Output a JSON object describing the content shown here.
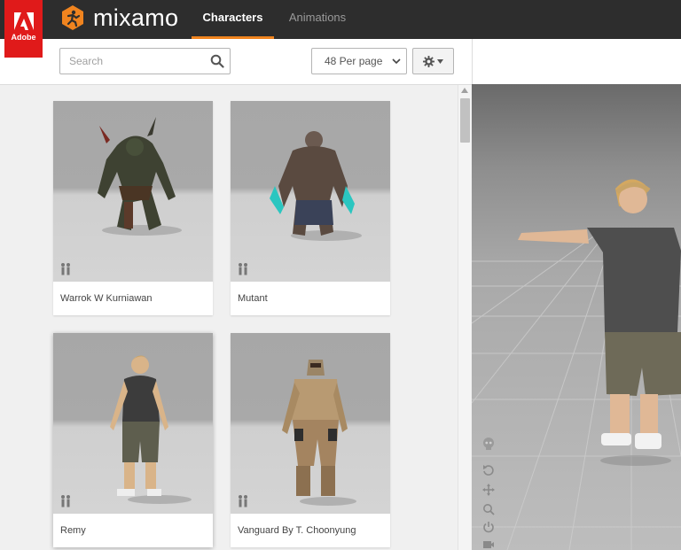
{
  "adobe": {
    "label": "Adobe"
  },
  "brand": {
    "name": "mixamo"
  },
  "nav": {
    "tabs": [
      {
        "label": "Characters",
        "active": true
      },
      {
        "label": "Animations",
        "active": false
      }
    ]
  },
  "toolbar": {
    "search_placeholder": "Search",
    "per_page": "48 Per page",
    "settings_icon": "gear-icon"
  },
  "characters": [
    {
      "name": "Warrok W Kurniawan",
      "icon": "people-icon"
    },
    {
      "name": "Mutant",
      "icon": "people-icon"
    },
    {
      "name": "Remy",
      "icon": "people-icon",
      "selected": true
    },
    {
      "name": "Vanguard By T. Choonyung",
      "icon": "people-icon"
    }
  ],
  "viewer_tools": [
    "skull-icon",
    "reset-icon",
    "move-icon",
    "zoom-icon",
    "power-icon",
    "camera-icon"
  ],
  "colors": {
    "accent": "#f0841f",
    "adobe_red": "#e01a1a",
    "topbar": "#2d2d2d"
  }
}
